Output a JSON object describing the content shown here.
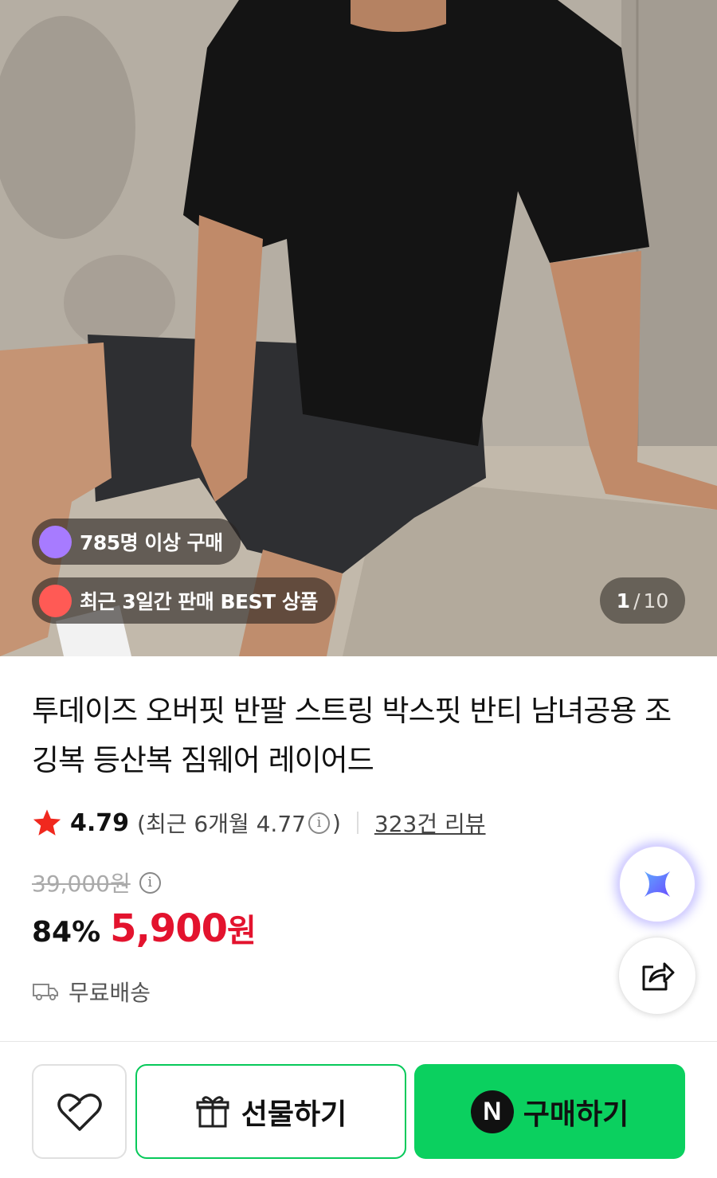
{
  "hero": {
    "badges": {
      "buyers": "785명 이상 구매",
      "best": "최근 3일간 판매 BEST 상품"
    },
    "counter": {
      "current": "1",
      "separator": "/",
      "total": "10"
    }
  },
  "product": {
    "title": "투데이즈 오버핏 반팔 스트링 박스핏 반티 남녀공용 조깅복 등산복 짐웨어 레이어드",
    "rating": {
      "score": "4.79",
      "recent_open": "(최근 6개월 4.77",
      "recent_close": ")",
      "reviews": "323건 리뷰"
    },
    "original_price": "39,000원",
    "discount": "84%",
    "price": "5,900",
    "currency": "원",
    "shipping": "무료배송"
  },
  "actions": {
    "gift_label": "선물하기",
    "buy_label": "구매하기",
    "npay_letter": "N"
  },
  "colors": {
    "accent_green": "#0bd05f",
    "price_red": "#e3132e",
    "star_red": "#f0281e"
  }
}
